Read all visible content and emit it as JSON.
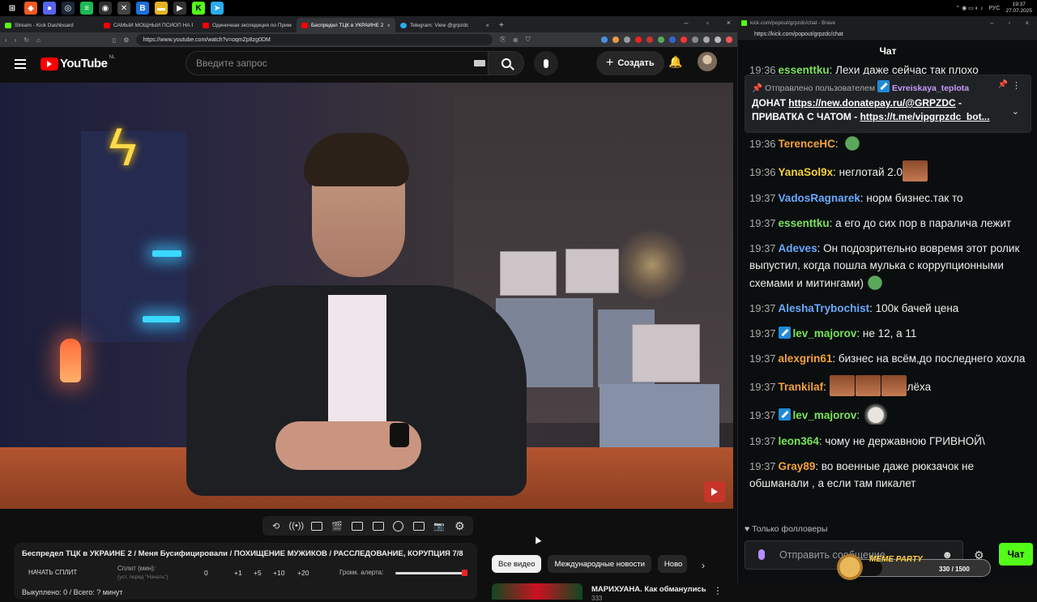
{
  "taskbar": {
    "lang": "РУС",
    "time": "19:37",
    "date": "27.07.2025"
  },
  "browser": {
    "tabs": [
      {
        "label": "Stream - Kick Dashboard",
        "color": "#53fc18"
      },
      {
        "label": "САМЫЙ МОЩНЫЙ ПСИОП НА РУ",
        "color": "#ff0000"
      },
      {
        "label": "Одиночная экспедиция по Примо",
        "color": "#ff0000"
      },
      {
        "label": "Беспредел ТЦК в УКРАИНЕ 2",
        "color": "#ff0000"
      },
      {
        "label": "Telegram: View @grpzdc",
        "color": "#2aabee"
      }
    ],
    "url": "https://www.youtube.com/watch?v=oqmZp8zg0DM"
  },
  "youtube": {
    "logo": "YouTube",
    "country": "NL",
    "search_placeholder": "Введите запрос",
    "create_label": "Создать",
    "chips": [
      "Все видео",
      "Международные новости",
      "Ново"
    ],
    "rec_title": "МАРИХУАНА. Как обманулись",
    "rec_sub": "333"
  },
  "panel": {
    "title": "Беспредел ТЦК в УКРАИНЕ 2 / Меня Бусифицировали / ПОХИЩЕНИЕ МУЖИКОВ / РАССЛЕДОВАНИЕ, КОРУПЦИЯ 7/8",
    "start_split": "НАЧАТЬ СПЛИТ",
    "split_label": "Сплит (мин):",
    "split_hint": "(уст. перед \"Начать\")",
    "split_value": "0",
    "increments": [
      "+1",
      "+5",
      "+10",
      "+20"
    ],
    "alert_label": "Громк. алерта:",
    "alert_volume": 1.0,
    "bought": "Выкуплено: 0 / Всего: ? минут"
  },
  "kick": {
    "window_title": "kick.com/popout/grpzdc/chat - Brave",
    "url": "https://kick.com/popout/grpzdc/chat",
    "chat_title": "Чат",
    "pinned": {
      "by_label": "Отправлено пользователем",
      "user": "Evreiskaya_teplota",
      "line1_prefix": "ДОНАТ ",
      "line1_link": "https://new.donatepay.ru/@GRPZDC",
      "line1_suffix": " -",
      "line2_prefix": "ПРИВАТКА С ЧАТОМ - ",
      "line2_link": "https://t.me/vipgrpzdc_bot..."
    },
    "top_partial": {
      "time": "19:36",
      "user": "essenttku",
      "text": "Лехи даже сейчас так плохо"
    },
    "messages": [
      {
        "time": "19:36",
        "user": "TerenceHC",
        "color": "#f4a23a",
        "text": ""
      },
      {
        "time": "19:36",
        "user": "YanaSol9x",
        "color": "#f4d03a",
        "text": "неглотай 2.0"
      },
      {
        "time": "19:37",
        "user": "VadosRagnarek",
        "color": "#6aa8ff",
        "text": "норм бизнес.так то"
      },
      {
        "time": "19:37",
        "user": "essenttku",
        "color": "#7be35a",
        "text": "а его до сих пор в паралича лежит"
      },
      {
        "time": "19:37",
        "user": "Adeves",
        "color": "#6aa8ff",
        "text": "Он подозрительно вовремя этот ролик выпустил, когда пошла мулька с коррупционными схемами и митингами)"
      },
      {
        "time": "19:37",
        "user": "AleshaTrybochist",
        "color": "#6aa8ff",
        "text": "100к бачей цена"
      },
      {
        "time": "19:37",
        "user": "lev_majorov",
        "color": "#7be35a",
        "text": "не 12, а 11"
      },
      {
        "time": "19:37",
        "user": "alexgrin61",
        "color": "#f4a23a",
        "text": "бизнес на всём,до последнего хохла"
      },
      {
        "time": "19:37",
        "user": "Trankilaf",
        "color": "#f4a23a",
        "text": "лёха"
      },
      {
        "time": "19:37",
        "user": "lev_majorov",
        "color": "#7be35a",
        "text": ""
      },
      {
        "time": "19:37",
        "user": "leon364",
        "color": "#7be35a",
        "text": "чому не державною ГРИВНОЙ\\"
      },
      {
        "time": "19:37",
        "user": "Gray89",
        "color": "#f4a23a",
        "text": "во военные даже рюкзачок не обшманали , а если там пикалет"
      }
    ],
    "followers_only": "Только фолловеры",
    "input_placeholder": "Отправить сообщение",
    "send_label": "Чат",
    "meme_party": "MEME PARTY",
    "meme_count": "330 / 1500"
  }
}
